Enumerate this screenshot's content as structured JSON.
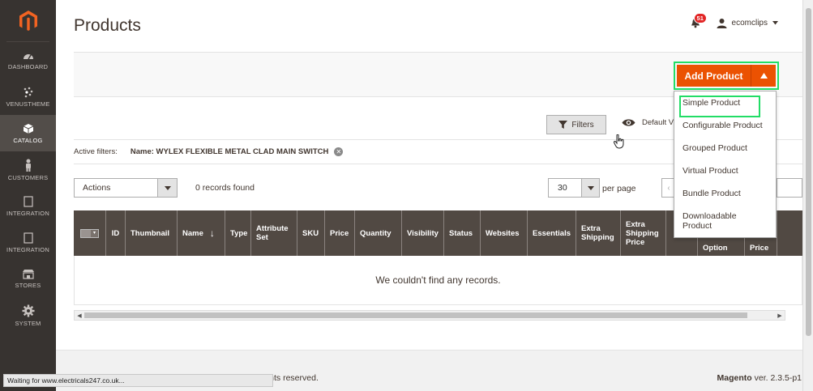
{
  "sidebar": {
    "items": [
      {
        "label": "DASHBOARD",
        "icon": "dashboard-icon"
      },
      {
        "label": "VENUSTHEME",
        "icon": "venustheme-icon"
      },
      {
        "label": "CATALOG",
        "icon": "catalog-icon",
        "active": true
      },
      {
        "label": "CUSTOMERS",
        "icon": "customers-icon"
      },
      {
        "label": "INTEGRATION",
        "icon": "integration-icon"
      },
      {
        "label": "INTEGRATION",
        "icon": "integration-icon"
      },
      {
        "label": "STORES",
        "icon": "stores-icon"
      },
      {
        "label": "SYSTEM",
        "icon": "gear-icon"
      }
    ]
  },
  "header": {
    "title": "Products",
    "notifications_count": "51",
    "user_name": "ecomclips"
  },
  "toolbar": {
    "add_product_label": "Add Product",
    "filters_label": "Filters",
    "view_label": "Default V"
  },
  "add_menu": {
    "items": [
      "Simple Product",
      "Configurable Product",
      "Grouped Product",
      "Virtual Product",
      "Bundle Product",
      "Downloadable Product"
    ]
  },
  "filters": {
    "active_label": "Active filters:",
    "chip": "Name: WYLEX FLEXIBLE METAL CLAD MAIN SWITCH"
  },
  "listing": {
    "actions_label": "Actions",
    "records_found": "0 records found",
    "per_page_value": "30",
    "per_page_label": "per page"
  },
  "grid": {
    "columns": [
      "ID",
      "Thumbnail",
      "Name",
      "Type",
      "Attribute Set",
      "SKU",
      "Price",
      "Quantity",
      "Visibility",
      "Status",
      "Websites",
      "Essentials",
      "Extra Shipping",
      "Extra Shipping Price",
      "",
      "Option",
      "Price"
    ],
    "sort_arrow": "↓",
    "empty_message": "We couldn't find any records."
  },
  "footer": {
    "rights": "ights reserved.",
    "brand": "Magento",
    "version": "ver. 2.3.5-p1"
  },
  "browser": {
    "status": "Waiting for www.electricals247.co.uk..."
  },
  "colors": {
    "accent": "#eb5202",
    "sidebar": "#373330",
    "highlight": "#22dd66",
    "grid_header": "#514943"
  }
}
